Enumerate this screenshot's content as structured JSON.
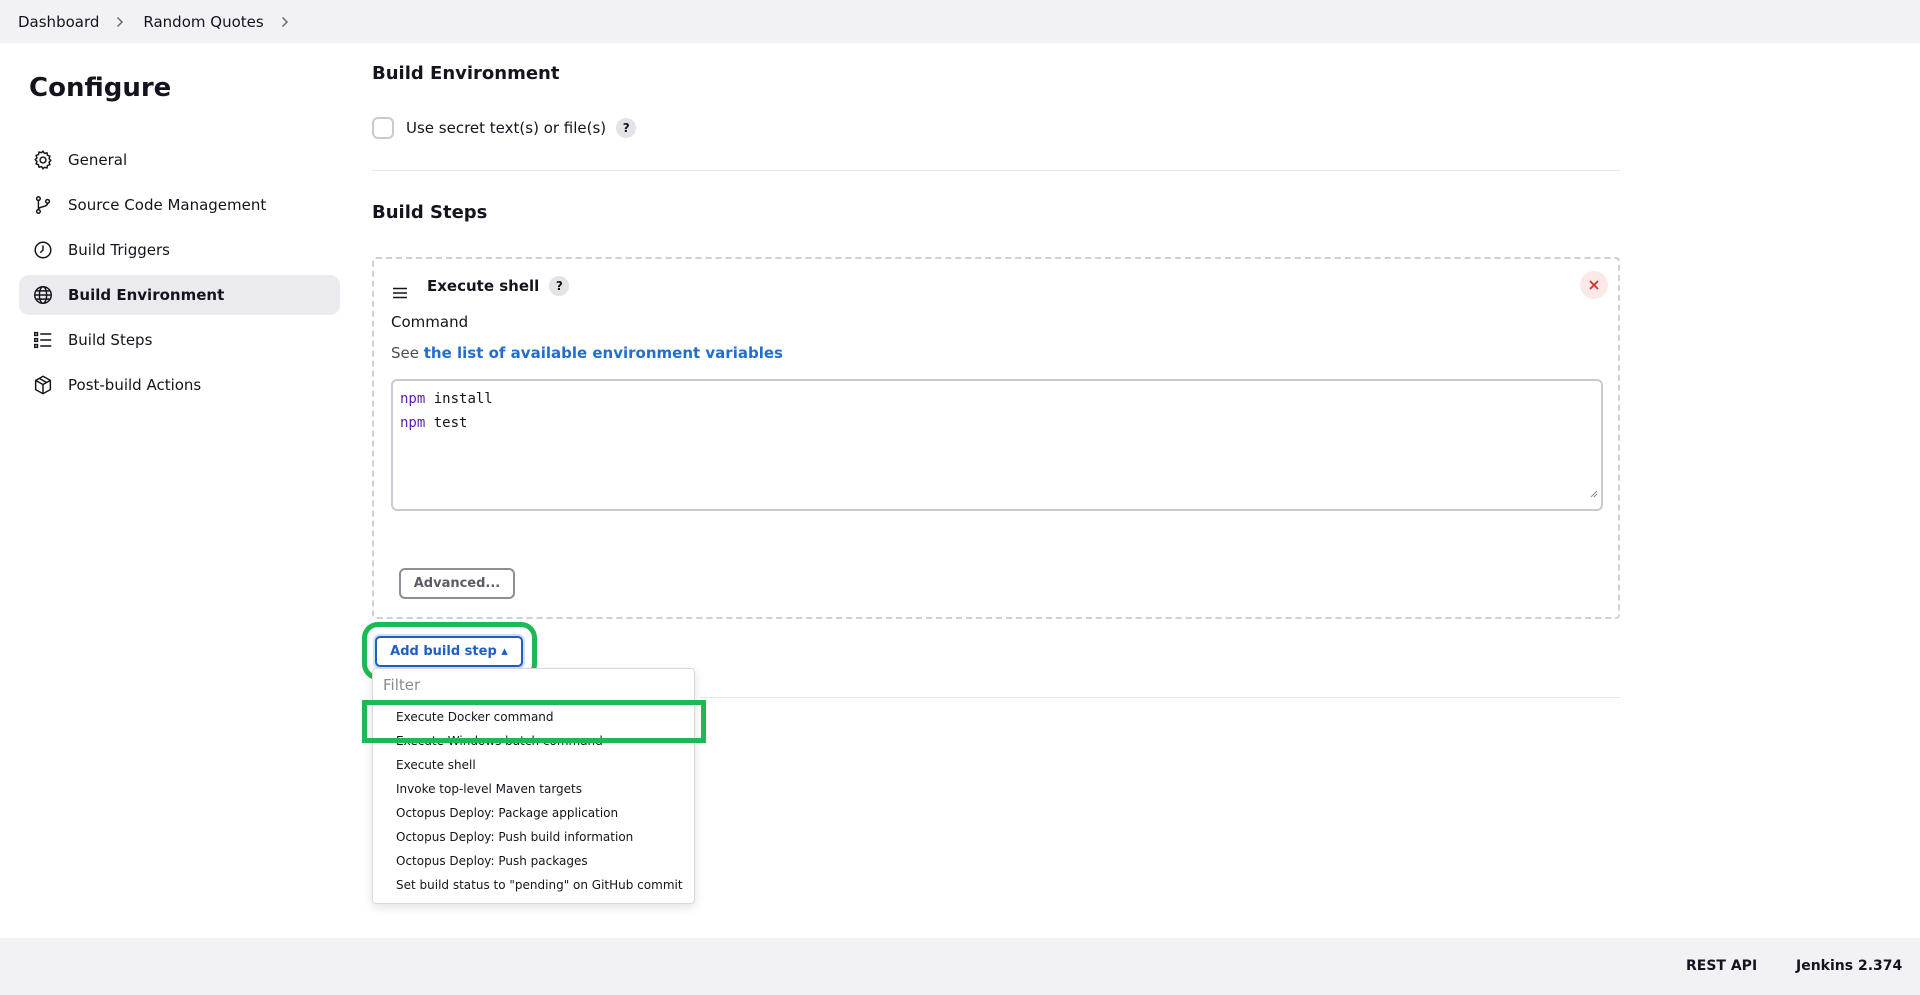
{
  "breadcrumb": {
    "items": [
      "Dashboard",
      "Random Quotes"
    ]
  },
  "sidebar": {
    "title": "Configure",
    "items": [
      {
        "label": "General",
        "icon": "gear-icon"
      },
      {
        "label": "Source Code Management",
        "icon": "branch-icon"
      },
      {
        "label": "Build Triggers",
        "icon": "clock-icon"
      },
      {
        "label": "Build Environment",
        "icon": "globe-icon",
        "active": true
      },
      {
        "label": "Build Steps",
        "icon": "list-icon"
      },
      {
        "label": "Post-build Actions",
        "icon": "package-icon"
      }
    ]
  },
  "build_environment": {
    "title": "Build Environment",
    "secret_checkbox_label": "Use secret text(s) or file(s)",
    "help": "?"
  },
  "build_steps": {
    "title": "Build Steps",
    "step": {
      "title": "Execute shell",
      "help": "?",
      "command_label": "Command",
      "see_prefix": "See",
      "env_link": "the list of available environment variables",
      "code_lines": [
        {
          "kw": "npm",
          "rest": " install"
        },
        {
          "kw": "npm",
          "rest": " test"
        }
      ],
      "advanced_label": "Advanced..."
    },
    "add_button_label": "Add build step ▴"
  },
  "dropdown": {
    "filter_placeholder": "Filter",
    "items": [
      "Execute Docker command",
      "Execute Windows batch command",
      "Execute shell",
      "Invoke top-level Maven targets",
      "Octopus Deploy: Package application",
      "Octopus Deploy: Push build information",
      "Octopus Deploy: Push packages",
      "Set build status to \"pending\" on GitHub commit"
    ]
  },
  "footer": {
    "rest_api": "REST API",
    "version": "Jenkins 2.374"
  },
  "colors": {
    "accent": "#1f5fc4",
    "highlight": "#1db954",
    "link": "#1f6fd0"
  }
}
